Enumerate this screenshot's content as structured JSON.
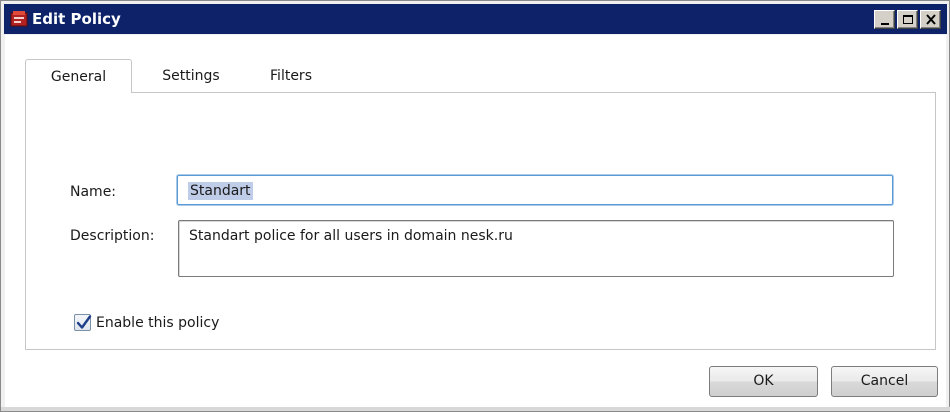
{
  "window": {
    "title": "Edit Policy",
    "icon": "policy-app-icon",
    "controls": [
      "minimize-icon",
      "maximize-icon",
      "close-icon"
    ]
  },
  "tabs": [
    {
      "label": "General",
      "active": true
    },
    {
      "label": "Settings",
      "active": false
    },
    {
      "label": "Filters",
      "active": false
    }
  ],
  "form": {
    "name_label": "Name:",
    "name_value": "Standart",
    "description_label": "Description:",
    "description_value": "Standart police for all users in domain nesk.ru",
    "enable_label": "Enable this policy",
    "enable_checked": true
  },
  "buttons": {
    "ok_label": "OK",
    "cancel_label": "Cancel"
  },
  "colors": {
    "titlebar": "#0d2269",
    "focus_border": "#5a9bd5",
    "selection": "#c0cde8"
  }
}
